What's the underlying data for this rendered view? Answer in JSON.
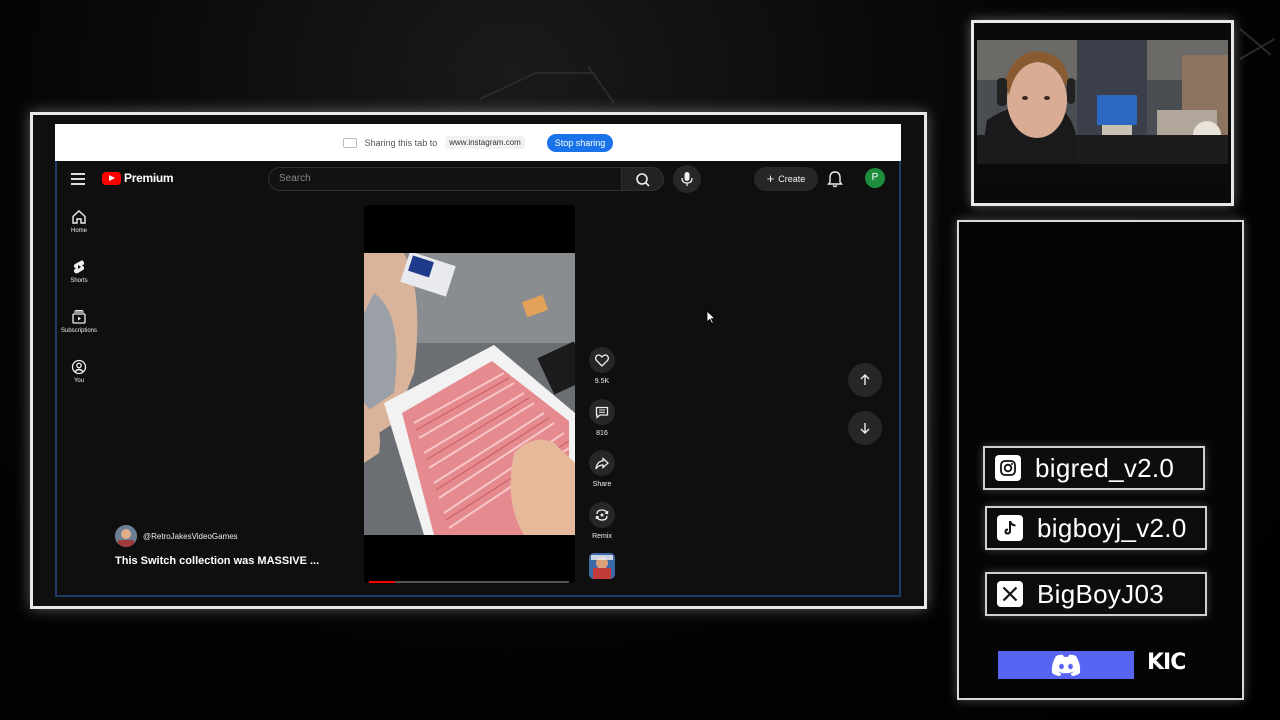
{
  "share_bar": {
    "text": "Sharing this tab to",
    "site": "www.instagram.com",
    "stop_label": "Stop sharing"
  },
  "youtube": {
    "logo_text": "Premium",
    "search_placeholder": "Search",
    "create_label": "Create",
    "avatar_letter": "P",
    "nav": [
      {
        "label": "Home",
        "icon": "home-icon"
      },
      {
        "label": "Shorts",
        "icon": "shorts-icon"
      },
      {
        "label": "Subscriptions",
        "icon": "subscriptions-icon"
      },
      {
        "label": "You",
        "icon": "you-icon"
      }
    ],
    "actions": {
      "like_count": "9.5K",
      "comment_count": "816",
      "share_label": "Share",
      "remix_label": "Remix"
    },
    "channel_name": "@RetroJakesVideoGames",
    "video_title": "This Switch collection was MASSIVE ...",
    "progress": 0.13
  },
  "socials": {
    "instagram": "bigred_v2.0",
    "tiktok": "bigboyj_v2.0",
    "x": "BigBoyJ03",
    "kick_logo": "KIC"
  },
  "colors": {
    "yt_red": "#ff0000",
    "stop_blue": "#1a73e8",
    "discord": "#5865f2",
    "avatar_green": "#1e8e3e"
  }
}
